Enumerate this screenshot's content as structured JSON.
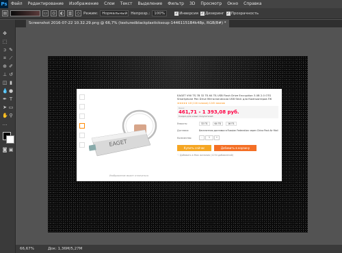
{
  "app": {
    "logo": "Ps"
  },
  "menu": [
    "Файл",
    "Редактирование",
    "Изображение",
    "Слои",
    "Текст",
    "Выделение",
    "Фильтр",
    "3D",
    "Просмотр",
    "Окно",
    "Справка"
  ],
  "options": {
    "mode_label": "Режим:",
    "mode_value": "Нормальный",
    "opacity_label": "Непрозр.:",
    "opacity_value": "100%",
    "inversion_label": "Инверсия",
    "dither_label": "Дизеринг",
    "transparency_label": "Прозрачность"
  },
  "document": {
    "tab_title": "Screenshot 2016-07-22 10.32.29.png @ 66,7% (texturedblackplasticksoup-14461151B4k48p, RGB/8#) *"
  },
  "product": {
    "title": "EAGET V90 TS.7B 32 ТБ 64 ТБ USB Flash Drive Encryption 3.0B 2.0 OTG Smartphone Pen Drive Металлическая USB Stick для Компьютеров ПК",
    "rating_text": "★★★★★ 4.8 (116 голосов)   1245 заказов",
    "price_label": "Цена:",
    "price_value": "461,71 - 1 393,08 руб.",
    "price_note": "Скидка для новых покупателей",
    "capacity_label": "Емкость:",
    "capacity_options": [
      "32 ГБ",
      "64 ГБ",
      "16 ГБ"
    ],
    "shipping_label": "Доставка:",
    "shipping_value": "Бесплатная доставка в Russian Federation через China Post Air Mail",
    "quantity_label": "Количество:",
    "quantity_value": "1",
    "quantity_minus": "-",
    "quantity_plus": "+",
    "buy_label": "Купить сейчас",
    "cart_label": "Добавить в корзину",
    "wishlist": "♡ Добавить в Мои желания (1234 добавлений)",
    "footnote": "Изображение может отличаться"
  },
  "status": {
    "zoom": "66,67%",
    "doc": "Док: 1,36M/5,27M"
  },
  "colors": {
    "panel": "#3a3a3a",
    "menubar": "#444444",
    "workspace": "#535353",
    "price": "#ff0044",
    "buy": "#f5a623",
    "cart": "#f46f25"
  }
}
